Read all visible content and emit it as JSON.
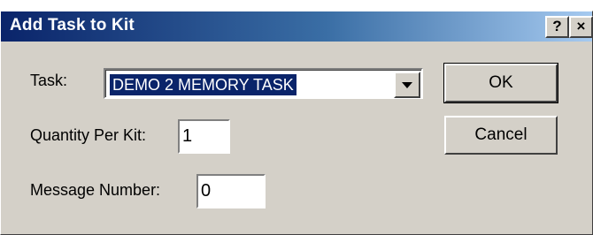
{
  "window": {
    "title": "Add Task to Kit",
    "help_label": "?",
    "close_label": "×"
  },
  "form": {
    "task_label": "Task:",
    "task_value": "DEMO 2 MEMORY TASK",
    "quantity_label": "Quantity Per Kit:",
    "quantity_value": "1",
    "message_label": "Message Number:",
    "message_value": "0"
  },
  "buttons": {
    "ok_label": "OK",
    "cancel_label": "Cancel"
  },
  "colors": {
    "titlebar_start": "#0a246a",
    "titlebar_end": "#a6caf0",
    "dialog_face": "#d4d0c8",
    "selection": "#0a246a"
  }
}
